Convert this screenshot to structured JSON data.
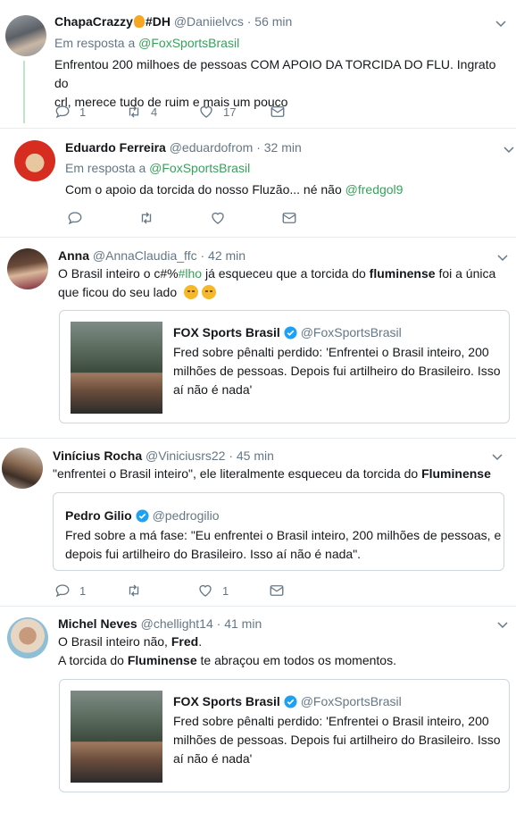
{
  "tweets": [
    {
      "name": "ChapaCrazzy",
      "name_suffix": "#DH",
      "handle": "@Daniielvcs",
      "time": "56 min",
      "reply_prefix": "Em resposta a",
      "reply_to": "@FoxSportsBrasil",
      "text_1": "Enfrentou 200 milhoes de pessoas COM APOIO DA TORCIDA DO FLU. Ingrato do",
      "text_2": "crl, merece tudo de ruim e mais um pouco",
      "replies": "1",
      "retweets": "4",
      "likes": "17"
    },
    {
      "name": "Eduardo Ferreira",
      "handle": "@eduardofrom",
      "time": "32 min",
      "reply_prefix": "Em resposta a",
      "reply_to": "@FoxSportsBrasil",
      "text": "Com o apoio da torcida do nosso Fluzão... né não",
      "mention": "@fredgol9"
    },
    {
      "name": "Anna",
      "handle": "@AnnaClaudia_ffc",
      "time": "42 min",
      "text_a": "O Brasil inteiro o c#%",
      "text_hashtag": "#lho",
      "text_b": " já esqueceu que a torcida do ",
      "text_bold": "fluminense",
      "text_c": " foi a única",
      "text_2": "que ficou do seu lado",
      "quote": {
        "name": "FOX Sports Brasil",
        "handle": "@FoxSportsBrasil",
        "text_1": "Fred sobre pênalti perdido: 'Enfrentei o Brasil inteiro, 200",
        "text_2": "milhões de pessoas. Depois fui artilheiro do Brasileiro. Isso",
        "text_3": "aí não é nada'"
      }
    },
    {
      "name": "Vinícius Rocha",
      "handle": "@Viniciusrs22",
      "time": "45 min",
      "text_a": "\"enfrentei o Brasil inteiro\", ele literalmente esqueceu da torcida do ",
      "text_bold": "Fluminense",
      "quote": {
        "name": "Pedro Gilio",
        "handle": "@pedrogilio",
        "text_1": "Fred sobre a má fase: \"Eu enfrentei o Brasil inteiro, 200 milhões de pessoas, e",
        "text_2": "depois fui artilheiro do Brasileiro. Isso aí não é nada\"."
      },
      "replies": "1",
      "likes": "1"
    },
    {
      "name": "Michel Neves",
      "handle": "@chellight14",
      "time": "41 min",
      "text_1a": "O Brasil inteiro não, ",
      "text_1b": "Fred",
      "text_1c": ".",
      "text_2a": "A torcida do ",
      "text_2b": "Fluminense",
      "text_2c": " te abraçou em todos os momentos.",
      "quote": {
        "name": "FOX Sports Brasil",
        "handle": "@FoxSportsBrasil",
        "text_1": "Fred sobre pênalti perdido: 'Enfrentei o Brasil inteiro, 200",
        "text_2": "milhões de pessoas. Depois fui artilheiro do Brasileiro. Isso",
        "text_3": "aí não é nada'"
      }
    }
  ],
  "separator": "·",
  "icons": {
    "reply": "reply-icon",
    "retweet": "retweet-icon",
    "like": "heart-icon",
    "dm": "envelope-icon",
    "caret": "chevron-down-icon",
    "verified": "verified-badge-icon"
  },
  "colors": {
    "link": "#38a05c",
    "muted": "#657786",
    "verified": "#1da1f2",
    "thread": "#bfe5c9"
  }
}
